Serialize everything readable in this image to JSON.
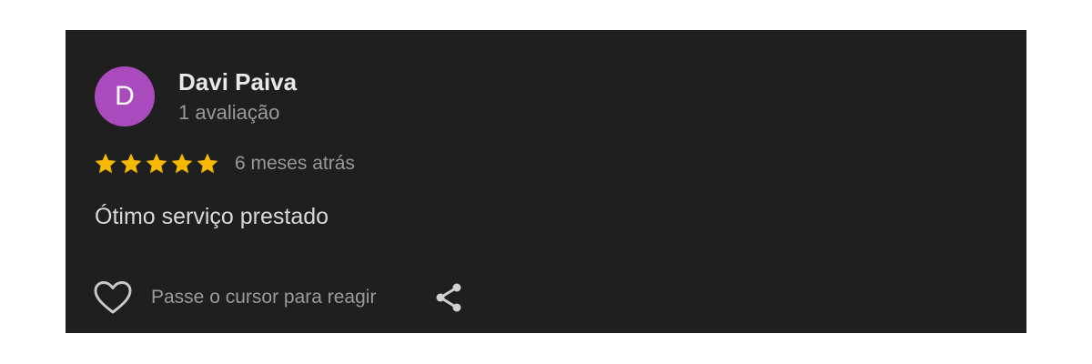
{
  "review": {
    "avatar_initial": "D",
    "avatar_color": "#a94bbd",
    "reviewer_name": "Davi Paiva",
    "reviewer_reviews": "1 avaliação",
    "rating": 5,
    "rating_max": 5,
    "star_color": "#f6b900",
    "time_ago": "6 meses atrás",
    "text": "Ótimo serviço prestado"
  },
  "actions": {
    "react_icon": "heart-icon",
    "react_label": "Passe o cursor para reagir",
    "share_icon": "share-icon"
  },
  "colors": {
    "card_background": "#1f1f1f",
    "page_background": "#ffffff"
  }
}
